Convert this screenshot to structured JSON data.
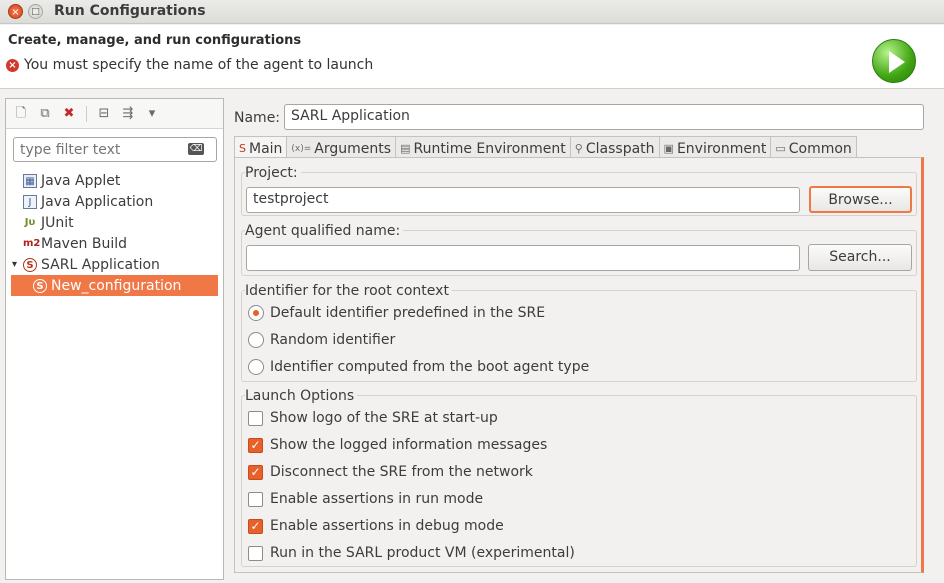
{
  "window": {
    "title": "Run Configurations",
    "close_glyph": "×",
    "max_glyph": "□"
  },
  "header": {
    "title": "Create, manage, and run configurations",
    "error_message": "You must specify the name of the agent to launch",
    "error_glyph": "×"
  },
  "left": {
    "filter_placeholder": "type filter text",
    "filter_clear_glyph": "⌫",
    "toolbar_glyphs": {
      "new": "🗋",
      "duplicate": "⧉",
      "delete": "✖",
      "collapse": "⊟",
      "filter": "⇶",
      "menu": "▾"
    },
    "tree": [
      {
        "label": "Java Applet",
        "icon": "java-applet-icon",
        "glyph": "▦"
      },
      {
        "label": "Java Application",
        "icon": "java-application-icon",
        "glyph": "J"
      },
      {
        "label": "JUnit",
        "icon": "junit-icon",
        "glyph": "Jυ"
      },
      {
        "label": "Maven Build",
        "icon": "maven-icon",
        "glyph": "m2"
      },
      {
        "label": "SARL Application",
        "icon": "sarl-icon",
        "glyph": "S",
        "expander": "▾"
      },
      {
        "label": "New_configuration",
        "icon": "sarl-config-icon",
        "glyph": "S",
        "selected": true
      }
    ]
  },
  "right": {
    "name_label": "Name:",
    "name_value": "SARL Application",
    "tabs": [
      {
        "label": "Main",
        "glyph": "S",
        "active": true
      },
      {
        "label": "Arguments",
        "glyph": "(x)="
      },
      {
        "label": "Runtime Environment",
        "glyph": "▤"
      },
      {
        "label": "Classpath",
        "glyph": "⚲"
      },
      {
        "label": "Environment",
        "glyph": "▣"
      },
      {
        "label": "Common",
        "glyph": "▭"
      }
    ],
    "project": {
      "label": "Project:",
      "value": "testproject",
      "browse_label": "Browse..."
    },
    "agent": {
      "label": "Agent qualified name:",
      "value": "",
      "search_label": "Search..."
    },
    "identifier": {
      "label": "Identifier for the root context",
      "options": [
        {
          "label": "Default identifier predefined in the SRE",
          "checked": true
        },
        {
          "label": "Random identifier",
          "checked": false
        },
        {
          "label": "Identifier computed from the boot agent type",
          "checked": false
        }
      ]
    },
    "launch": {
      "label": "Launch Options",
      "check_glyph": "✓",
      "options": [
        {
          "label": "Show logo of the SRE at start-up",
          "checked": false
        },
        {
          "label": "Show the logged information messages",
          "checked": true
        },
        {
          "label": "Disconnect the SRE from the network",
          "checked": true
        },
        {
          "label": "Enable assertions in run mode",
          "checked": false
        },
        {
          "label": "Enable assertions in debug mode",
          "checked": true
        },
        {
          "label": "Run in the SARL product VM (experimental)",
          "checked": false
        }
      ]
    }
  },
  "colors": {
    "accent": "#f07746",
    "error": "#d1392c",
    "run_green": "#3fa412"
  }
}
